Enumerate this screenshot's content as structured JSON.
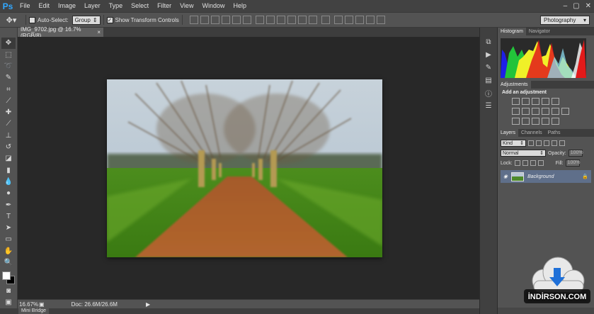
{
  "app": {
    "logo": "Ps"
  },
  "menu": [
    "File",
    "Edit",
    "Image",
    "Layer",
    "Type",
    "Select",
    "Filter",
    "View",
    "Window",
    "Help"
  ],
  "options": {
    "auto_select_label": "Auto-Select:",
    "auto_select_value": "Group",
    "show_transform_label": "Show Transform Controls",
    "workspace": "Photography"
  },
  "document": {
    "tab_title": "IMG_9702.jpg @ 16.7% (RGB/8)",
    "tab_close": "×"
  },
  "status": {
    "zoom": "16.67%",
    "doc_size": "Doc: 26.6M/26.6M"
  },
  "mini_bridge": "Mini Bridge",
  "panels": {
    "histogram_tabs": [
      "Histogram",
      "Navigator"
    ],
    "adjustments_tab": "Adjustments",
    "adjustments_title": "Add an adjustment",
    "layers_tabs": [
      "Layers",
      "Channels",
      "Paths"
    ],
    "kind_label": "Kind",
    "blend_mode": "Normal",
    "opacity_label": "Opacity:",
    "opacity_value": "100%",
    "lock_label": "Lock:",
    "fill_label": "Fill:",
    "fill_value": "100%",
    "layer_name": "Background"
  },
  "watermark": "İNDİRSON.COM",
  "colors": {
    "foreground": "#ffffff",
    "background": "#000000",
    "accent": "#31a8ff",
    "layer_selected": "#5f6f8a"
  }
}
